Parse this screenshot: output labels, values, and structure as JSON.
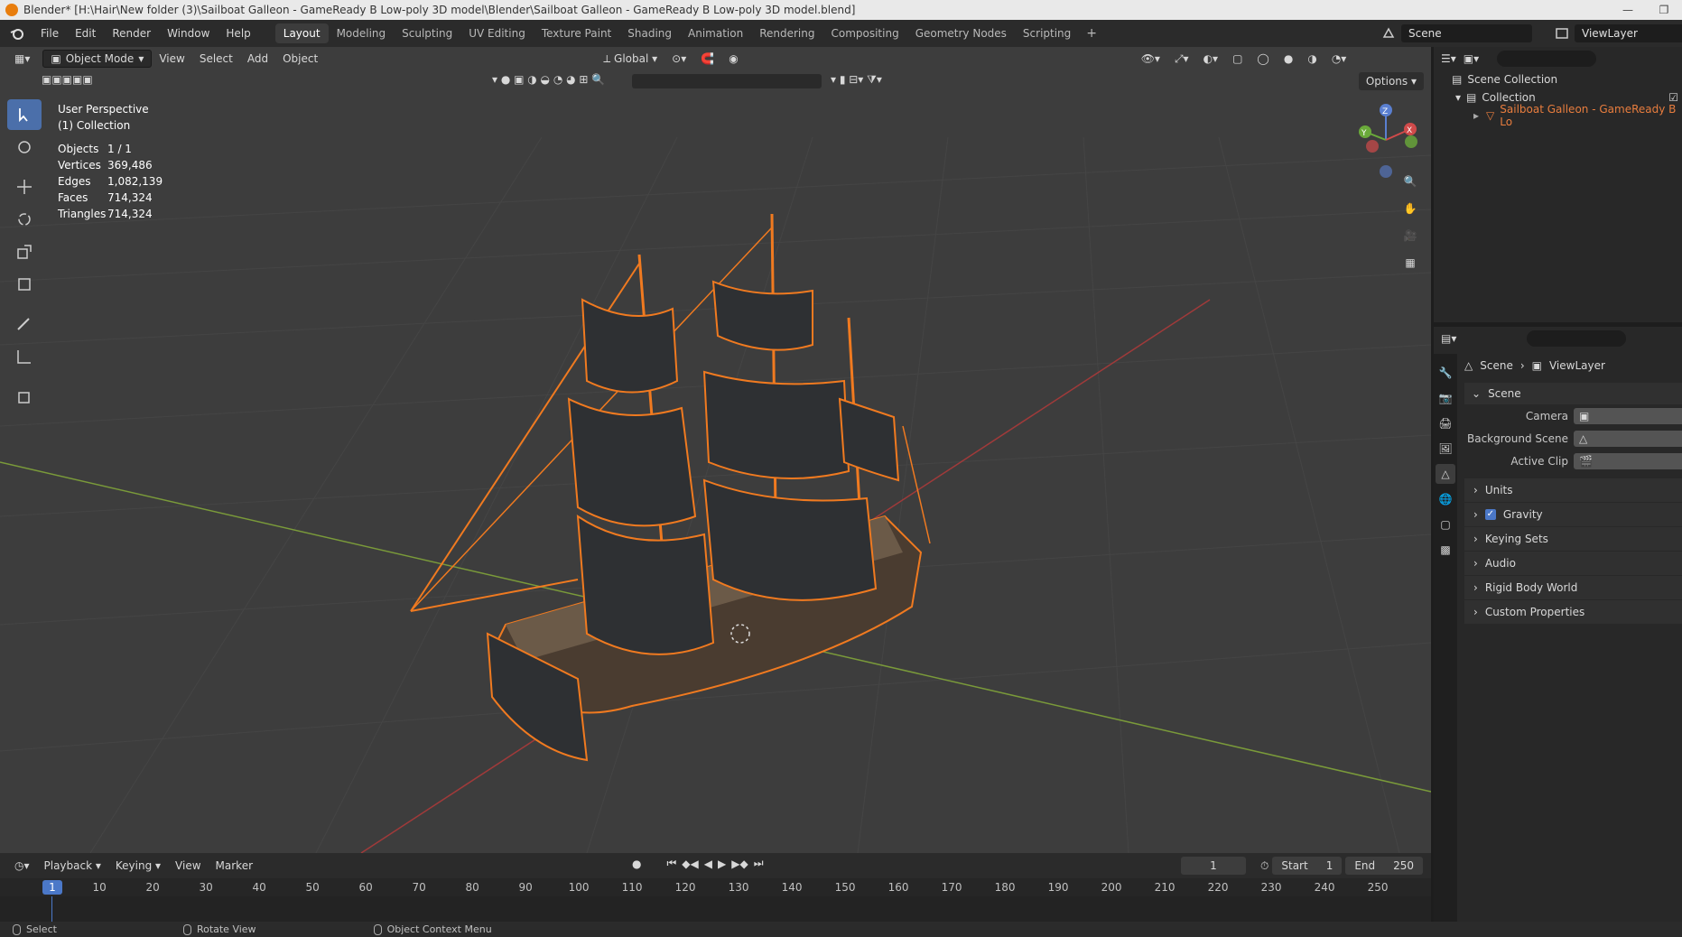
{
  "window": {
    "title": "Blender* [H:\\Hair\\New folder (3)\\Sailboat Galleon - GameReady B Low-poly 3D model\\Blender\\Sailboat Galleon - GameReady B Low-poly 3D model.blend]"
  },
  "menus": [
    "File",
    "Edit",
    "Render",
    "Window",
    "Help"
  ],
  "workspaces": [
    "Layout",
    "Modeling",
    "Sculpting",
    "UV Editing",
    "Texture Paint",
    "Shading",
    "Animation",
    "Rendering",
    "Compositing",
    "Geometry Nodes",
    "Scripting"
  ],
  "active_workspace": "Layout",
  "scene_name": "Scene",
  "viewlayer_name": "ViewLayer",
  "viewport": {
    "mode": "Object Mode",
    "menus": [
      "View",
      "Select",
      "Add",
      "Object"
    ],
    "transform_orientation": "Global",
    "options_label": "Options",
    "perspective_label": "User Perspective",
    "collection_label": "(1) Collection",
    "stats": [
      {
        "key": "Objects",
        "value": "1 / 1"
      },
      {
        "key": "Vertices",
        "value": "369,486"
      },
      {
        "key": "Edges",
        "value": "1,082,139"
      },
      {
        "key": "Faces",
        "value": "714,324"
      },
      {
        "key": "Triangles",
        "value": "714,324"
      }
    ],
    "gizmo_axes": [
      "Z",
      "Y",
      "X"
    ]
  },
  "timeline": {
    "menus": [
      "Playback",
      "Keying",
      "View",
      "Marker"
    ],
    "current_frame": "1",
    "start_label": "Start",
    "start": "1",
    "end_label": "End",
    "end": "250",
    "ticks": [
      "10",
      "20",
      "30",
      "40",
      "50",
      "60",
      "70",
      "80",
      "90",
      "100",
      "110",
      "120",
      "130",
      "140",
      "150",
      "160",
      "170",
      "180",
      "190",
      "200",
      "210",
      "220",
      "230",
      "240",
      "250"
    ]
  },
  "statusbar": {
    "select": "Select",
    "rotate": "Rotate View",
    "context": "Object Context Menu"
  },
  "outliner": {
    "scene_collection": "Scene Collection",
    "collection": "Collection",
    "object": "Sailboat Galleon - GameReady B Lo"
  },
  "properties": {
    "breadcrumb_scene": "Scene",
    "breadcrumb_viewlayer": "ViewLayer",
    "panel_title": "Scene",
    "rows": [
      {
        "label": "Camera"
      },
      {
        "label": "Background Scene"
      },
      {
        "label": "Active Clip"
      }
    ],
    "subpanels": [
      "Units",
      "Gravity",
      "Keying Sets",
      "Audio",
      "Rigid Body World",
      "Custom Properties"
    ]
  },
  "colors": {
    "accent_blue": "#4b78c8",
    "selection_orange": "#e87d3e",
    "viewport_bg": "#3d3d3d"
  }
}
